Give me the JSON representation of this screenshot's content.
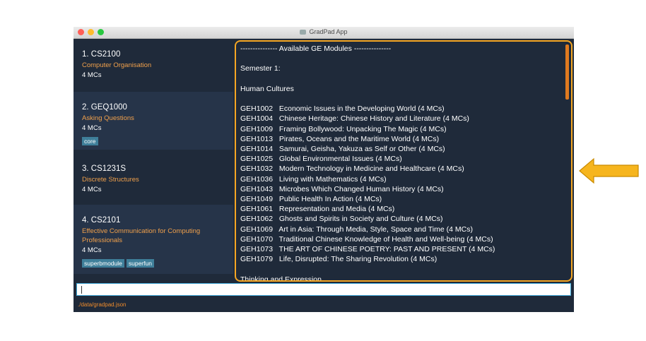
{
  "window": {
    "title": "GradPad App"
  },
  "modules": [
    {
      "index_code": "1.  CS2100",
      "name": "Computer Organisation",
      "mcs": "4 MCs",
      "tags": []
    },
    {
      "index_code": "2.  GEQ1000",
      "name": "Asking Questions",
      "mcs": "4 MCs",
      "tags": [
        "core"
      ]
    },
    {
      "index_code": "3.  CS1231S",
      "name": "Discrete Structures",
      "mcs": "4 MCs",
      "tags": []
    },
    {
      "index_code": "4.  CS2101",
      "name": "Effective Communication for Computing Professionals",
      "mcs": "4 MCs",
      "tags": [
        "superbmodule",
        "superfun"
      ]
    }
  ],
  "result": {
    "lines": [
      "--------------- Available GE Modules ---------------",
      "",
      "Semester 1:",
      "",
      "Human Cultures",
      "",
      "GEH1002   Economic Issues in the Developing World (4 MCs)",
      "GEH1004   Chinese Heritage: Chinese History and Literature (4 MCs)",
      "GEH1009   Framing Bollywood: Unpacking The Magic (4 MCs)",
      "GEH1013   Pirates, Oceans and the Maritime World (4 MCs)",
      "GEH1014   Samurai, Geisha, Yakuza as Self or Other (4 MCs)",
      "GEH1025   Global Environmental Issues (4 MCs)",
      "GEH1032   Modern Technology in Medicine and Healthcare (4 MCs)",
      "GEH1036   Living with Mathematics (4 MCs)",
      "GEH1043   Microbes Which Changed Human History (4 MCs)",
      "GEH1049   Public Health In Action (4 MCs)",
      "GEH1061   Representation and Media (4 MCs)",
      "GEH1062   Ghosts and Spirits in Society and Culture (4 MCs)",
      "GEH1069   Art in Asia: Through Media, Style, Space and Time (4 MCs)",
      "GEH1070   Traditional Chinese Knowledge of Health and Well-being (4 MCs)",
      "GEH1073   THE ART OF CHINESE POETRY: PAST AND PRESENT (4 MCs)",
      "GEH1079   Life, Disrupted: The Sharing Revolution (4 MCs)",
      "",
      "Thinking and Expression"
    ]
  },
  "command_box": {
    "value": ""
  },
  "status_bar": {
    "path": "./data/gradpad.json"
  },
  "colors": {
    "accent": "#f5a623",
    "background": "#1f2a3a",
    "module_name": "#f0a04b",
    "tag": "#3f7f9a"
  },
  "icons": {
    "pointer": "left-arrow-icon"
  }
}
